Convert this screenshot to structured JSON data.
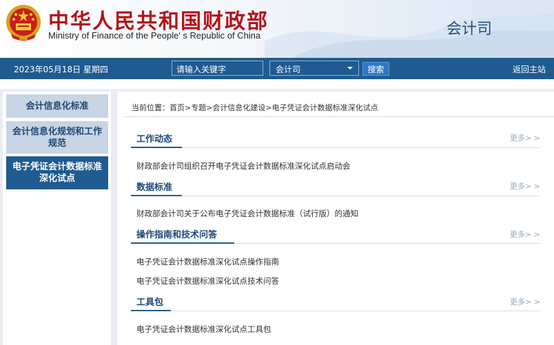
{
  "header": {
    "title_cn": "中华人民共和国财政部",
    "title_en": "Ministry of Finance of the People' s Republic of China",
    "department": "会计司",
    "emblem_icon": "national-emblem-icon"
  },
  "nav": {
    "date": "2023年05月18日  星期四",
    "search_placeholder": "请输入关键字",
    "select_value": "会计司",
    "search_button": "搜索",
    "back_home": "返回主站",
    "bar_color": "#1f5b91"
  },
  "sidebar": {
    "items": [
      {
        "label": "会计信息化标准",
        "active": false
      },
      {
        "label": "会计信息化规划和工作规范",
        "active": false
      },
      {
        "label": "电子凭证会计数据标准深化试点",
        "active": true
      }
    ]
  },
  "breadcrumb": "当前位置：首页>专题>会计信息化建设>电子凭证会计数据标准深化试点",
  "sections": [
    {
      "title": "工作动态",
      "more": "更多> >",
      "items": [
        "财政部会计司组织召开电子凭证会计数据标准深化试点启动会"
      ]
    },
    {
      "title": "数据标准",
      "more": "更多> >",
      "items": [
        "财政部会计司关于公布电子凭证会计数据标准（试行版）的通知"
      ]
    },
    {
      "title": "操作指南和技术问答",
      "more": "更多> >",
      "items": [
        "电子凭证会计数据标准深化试点操作指南",
        "电子凭证会计数据标准深化试点技术问答"
      ]
    },
    {
      "title": "工具包",
      "more": "更多> >",
      "items": [
        "电子凭证会计数据标准深化试点工具包"
      ]
    }
  ]
}
